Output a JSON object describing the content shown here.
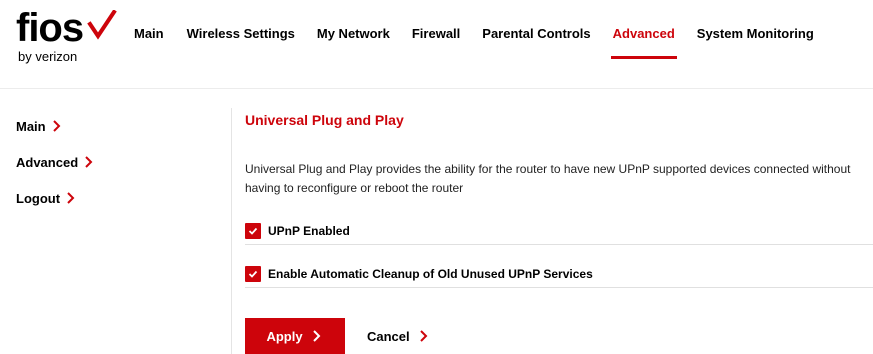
{
  "brand": {
    "logo_text": "fios",
    "logo_subtext": "by verizon",
    "accent_color": "#cd040b"
  },
  "nav": {
    "items": [
      {
        "label": "Main",
        "active": false
      },
      {
        "label": "Wireless Settings",
        "active": false
      },
      {
        "label": "My Network",
        "active": false
      },
      {
        "label": "Firewall",
        "active": false
      },
      {
        "label": "Parental Controls",
        "active": false
      },
      {
        "label": "Advanced",
        "active": true
      },
      {
        "label": "System Monitoring",
        "active": false
      }
    ]
  },
  "sidebar": {
    "items": [
      {
        "label": "Main",
        "icon": "chevron-right-icon"
      },
      {
        "label": "Advanced",
        "icon": "chevron-right-icon"
      },
      {
        "label": "Logout",
        "icon": "chevron-right-icon"
      }
    ]
  },
  "main": {
    "title": "Universal Plug and Play",
    "description": "Universal Plug and Play provides the ability for the router to have new UPnP supported devices connected without having to reconfigure or reboot the router",
    "options": [
      {
        "label": "UPnP Enabled",
        "checked": true
      },
      {
        "label": "Enable Automatic Cleanup of Old Unused UPnP Services",
        "checked": true
      }
    ],
    "apply_label": "Apply",
    "cancel_label": "Cancel"
  }
}
